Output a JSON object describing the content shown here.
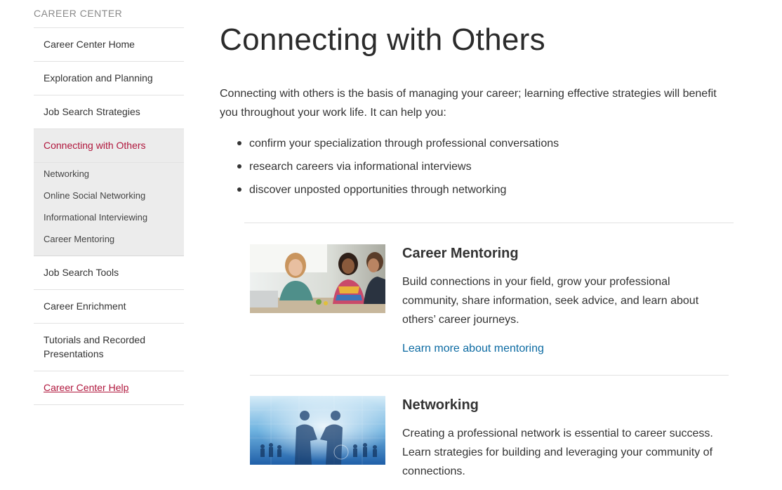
{
  "sidebar": {
    "heading": "CAREER CENTER",
    "items": [
      {
        "label": "Career Center Home"
      },
      {
        "label": "Exploration and Planning"
      },
      {
        "label": "Job Search Strategies"
      },
      {
        "label": "Connecting with Others"
      }
    ],
    "subitems": [
      {
        "label": "Networking"
      },
      {
        "label": "Online Social Networking"
      },
      {
        "label": "Informational Interviewing"
      },
      {
        "label": "Career Mentoring"
      }
    ],
    "items_after": [
      {
        "label": "Job Search Tools"
      },
      {
        "label": "Career Enrichment"
      },
      {
        "label": "Tutorials and Recorded Presentations"
      },
      {
        "label": "Career Center Help"
      }
    ]
  },
  "main": {
    "title": "Connecting with Others",
    "intro": "Connecting with others is the basis of managing your career; learning effective strategies will benefit you throughout your work life.  It can help you:",
    "bullets": [
      "confirm your specialization through professional conversations",
      "research careers via informational interviews",
      "discover unposted opportunities through networking"
    ],
    "cards": [
      {
        "title": "Career Mentoring",
        "text": "Build connections in your field, grow your professional community, share information, seek advice, and learn about others’ career journeys.",
        "link": "Learn more about mentoring"
      },
      {
        "title": "Networking",
        "text": "Creating a professional network is essential to career success. Learn strategies for building and leveraging your community of connections."
      }
    ]
  },
  "colors": {
    "accent": "#b0163c",
    "link": "#0b6aa2",
    "sidebar_active_bg": "#ececec"
  }
}
